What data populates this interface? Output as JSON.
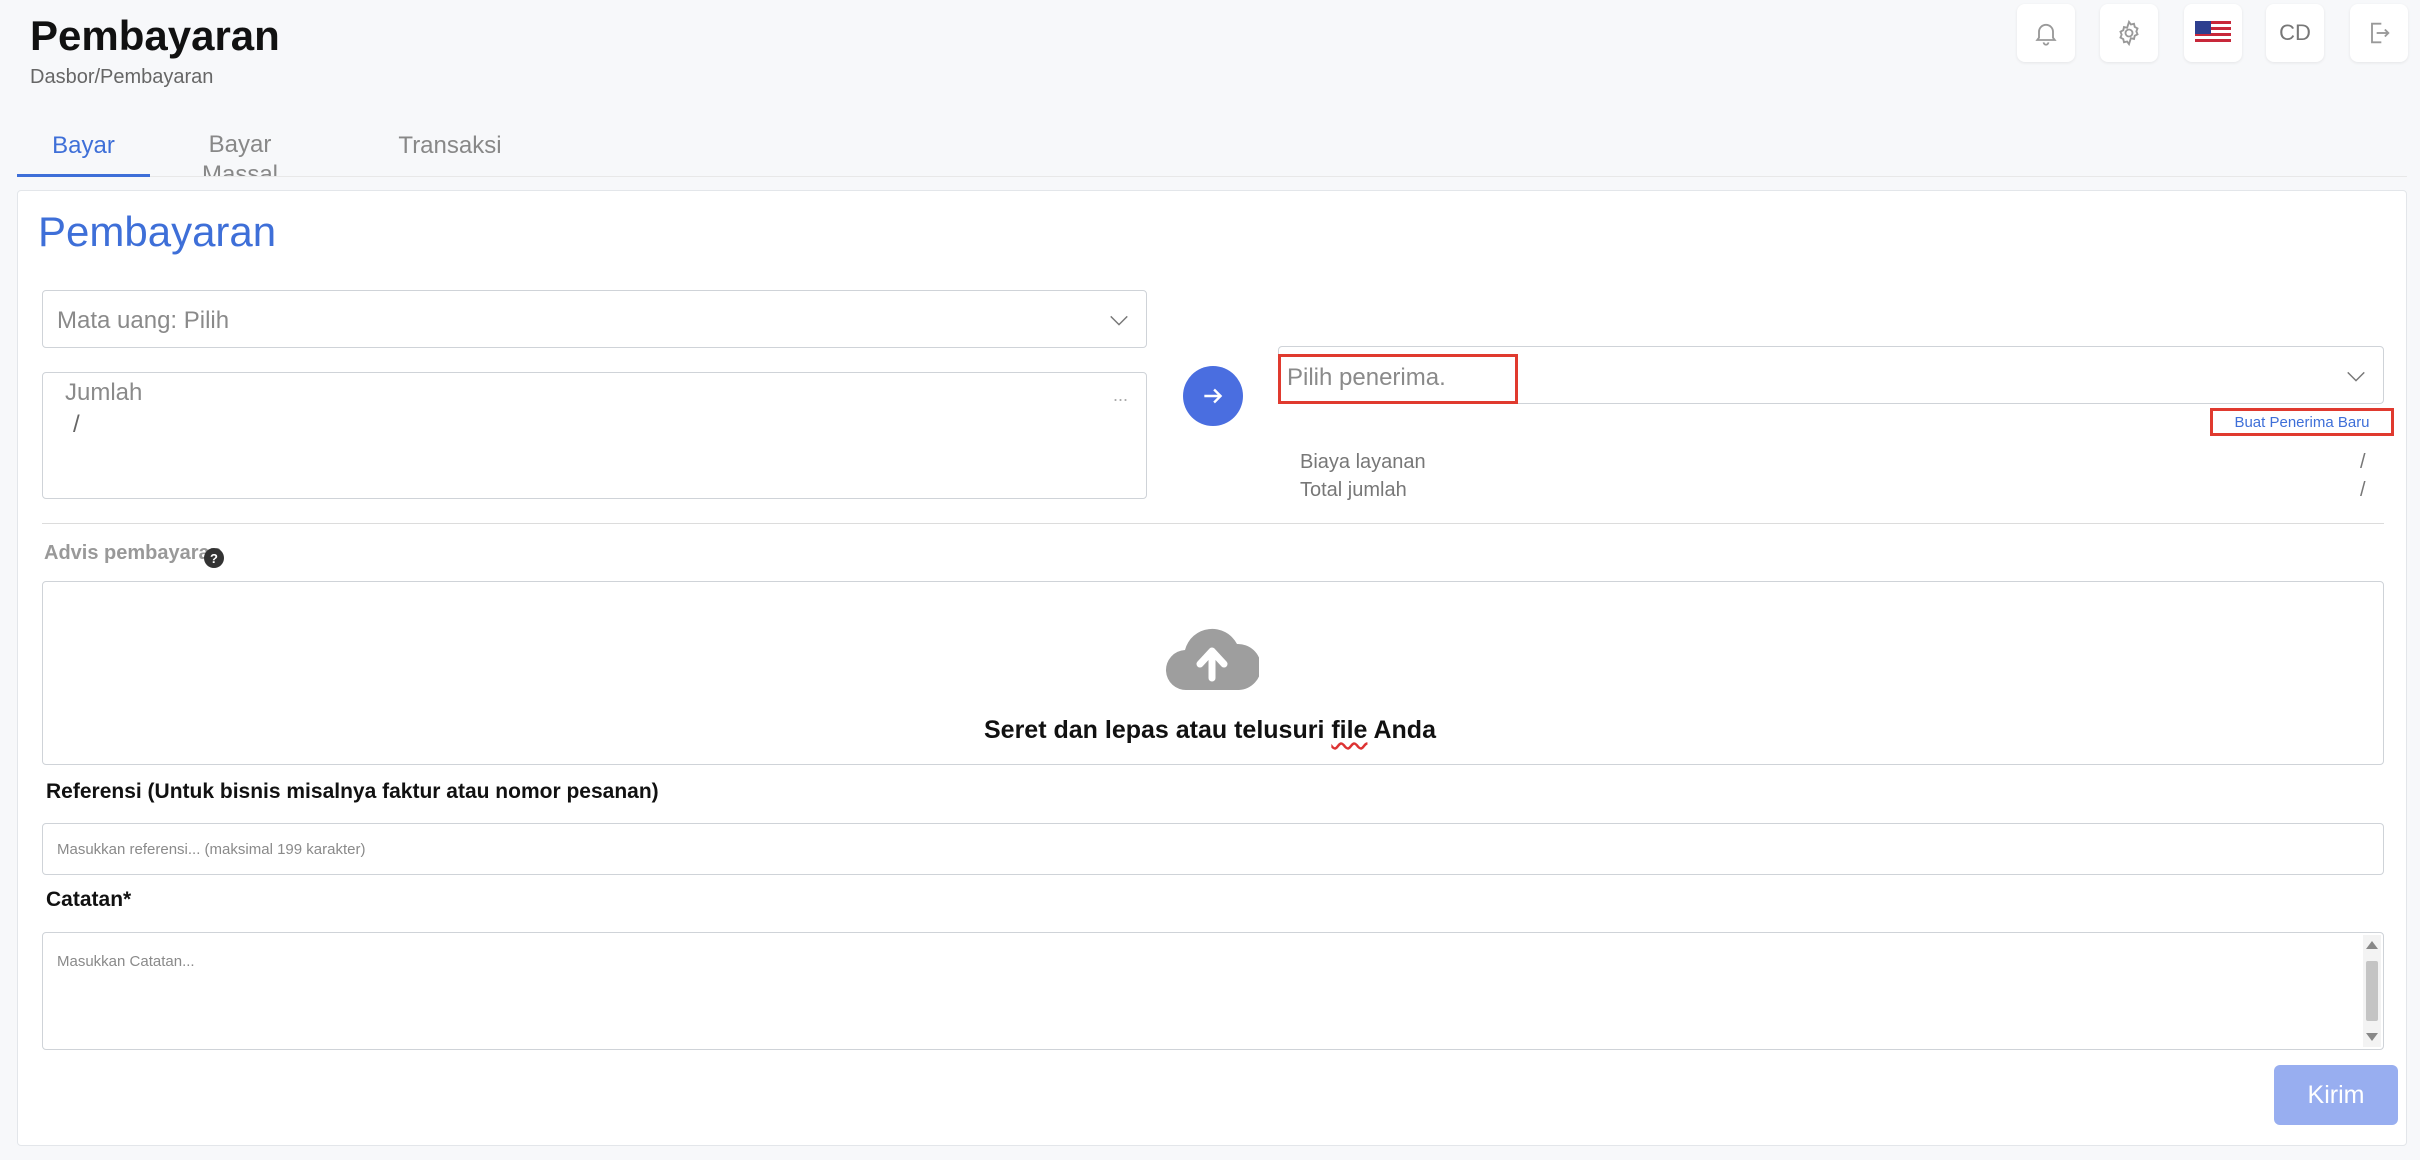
{
  "header": {
    "title": "Pembayaran",
    "breadcrumb": "Dasbor/Pembayaran",
    "avatar_initials": "CD"
  },
  "tabs": [
    {
      "label": "Bayar",
      "active": true
    },
    {
      "label": "Bayar Massal",
      "active": false
    },
    {
      "label": "Transaksi",
      "active": false
    }
  ],
  "form": {
    "section_title": "Pembayaran",
    "currency_placeholder": "Mata  uang: Pilih",
    "amount_label": "Jumlah",
    "amount_value": "/",
    "amount_more": "...",
    "recipient_placeholder": "Pilih penerima.",
    "new_recipient_link": "Buat Penerima Baru",
    "service_fee_label": "Biaya layanan",
    "service_fee_value": "/",
    "total_label": "Total jumlah",
    "total_value": "/",
    "advice_label": "Advis pembayaran",
    "help_glyph": "?",
    "dropzone_text_before": "Seret dan lepas atau telusuri ",
    "dropzone_text_link": "file",
    "dropzone_text_after": " Anda",
    "reference_label": "Referensi (Untuk bisnis misalnya faktur atau nomor pesanan)",
    "reference_placeholder": "Masukkan referensi... (maksimal 199 karakter)",
    "notes_label": "Catatan*",
    "notes_placeholder": "Masukkan Catatan...",
    "submit_label": "Kirim"
  },
  "icons": {
    "notification": "bell-icon",
    "settings": "gear-icon",
    "language": "us-flag-icon",
    "logout": "logout-icon",
    "upload": "cloud-upload-icon",
    "arrow": "arrow-right-icon"
  },
  "colors": {
    "accent": "#3e6fd8",
    "arrow_button": "#4a6ee0",
    "submit_disabled": "#98aef0",
    "highlight": "#e03a2f"
  }
}
